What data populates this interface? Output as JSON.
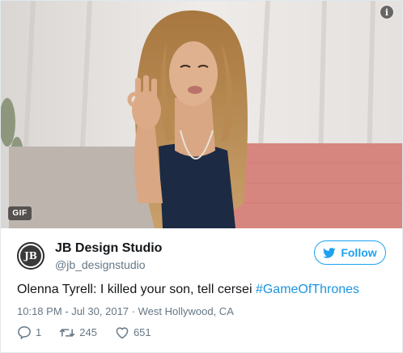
{
  "media": {
    "badge": "GIF",
    "info_glyph": "i"
  },
  "author": {
    "avatar_text": "JB",
    "display_name": "JB Design Studio",
    "handle": "@jb_designstudio"
  },
  "follow_button": {
    "label": "Follow"
  },
  "tweet": {
    "text": "Olenna Tyrell: I killed your son, tell cersei ",
    "hashtag": "#GameOfThrones"
  },
  "meta": {
    "timestamp": "10:18 PM - Jul 30, 2017",
    "separator": "·",
    "location": "West Hollywood, CA"
  },
  "actions": {
    "replies": "1",
    "retweets": "245",
    "likes": "651"
  },
  "colors": {
    "accent": "#1da1f2",
    "hashtag": "#1b95e0",
    "muted": "#657786"
  }
}
